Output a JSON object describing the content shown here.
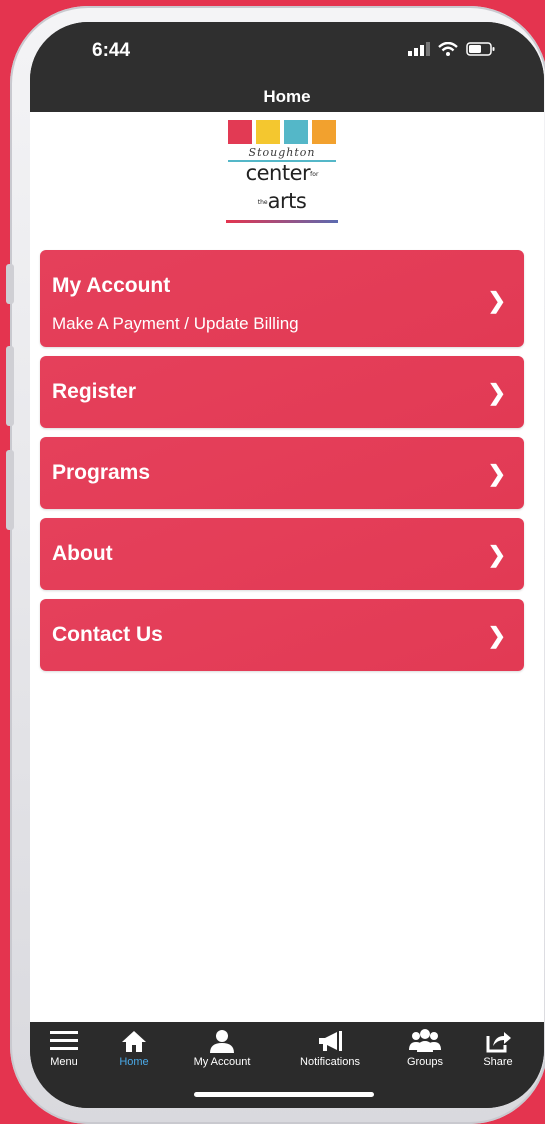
{
  "status": {
    "time": "6:44"
  },
  "header": {
    "title": "Home"
  },
  "logo": {
    "script_text": "Stoughton",
    "main_text": "center",
    "small_text": "for the",
    "tail_text": "arts"
  },
  "menu": {
    "items": [
      {
        "label": "My Account",
        "sub": "Make A Payment / Update Billing"
      },
      {
        "label": "Register"
      },
      {
        "label": "Programs"
      },
      {
        "label": "About"
      },
      {
        "label": "Contact Us"
      }
    ],
    "chevron": "❯"
  },
  "tabs": [
    {
      "label": "Menu",
      "icon": "hamburger-icon",
      "active": false
    },
    {
      "label": "Home",
      "icon": "home-icon",
      "active": true
    },
    {
      "label": "My Account",
      "icon": "person-icon",
      "active": false
    },
    {
      "label": "Notifications",
      "icon": "megaphone-icon",
      "active": false
    },
    {
      "label": "Groups",
      "icon": "groups-icon",
      "active": false
    },
    {
      "label": "Share",
      "icon": "share-icon",
      "active": false
    }
  ],
  "colors": {
    "accent": "#e4344f",
    "active_tab": "#4aa8e6",
    "bar": "#2f2f2f"
  }
}
